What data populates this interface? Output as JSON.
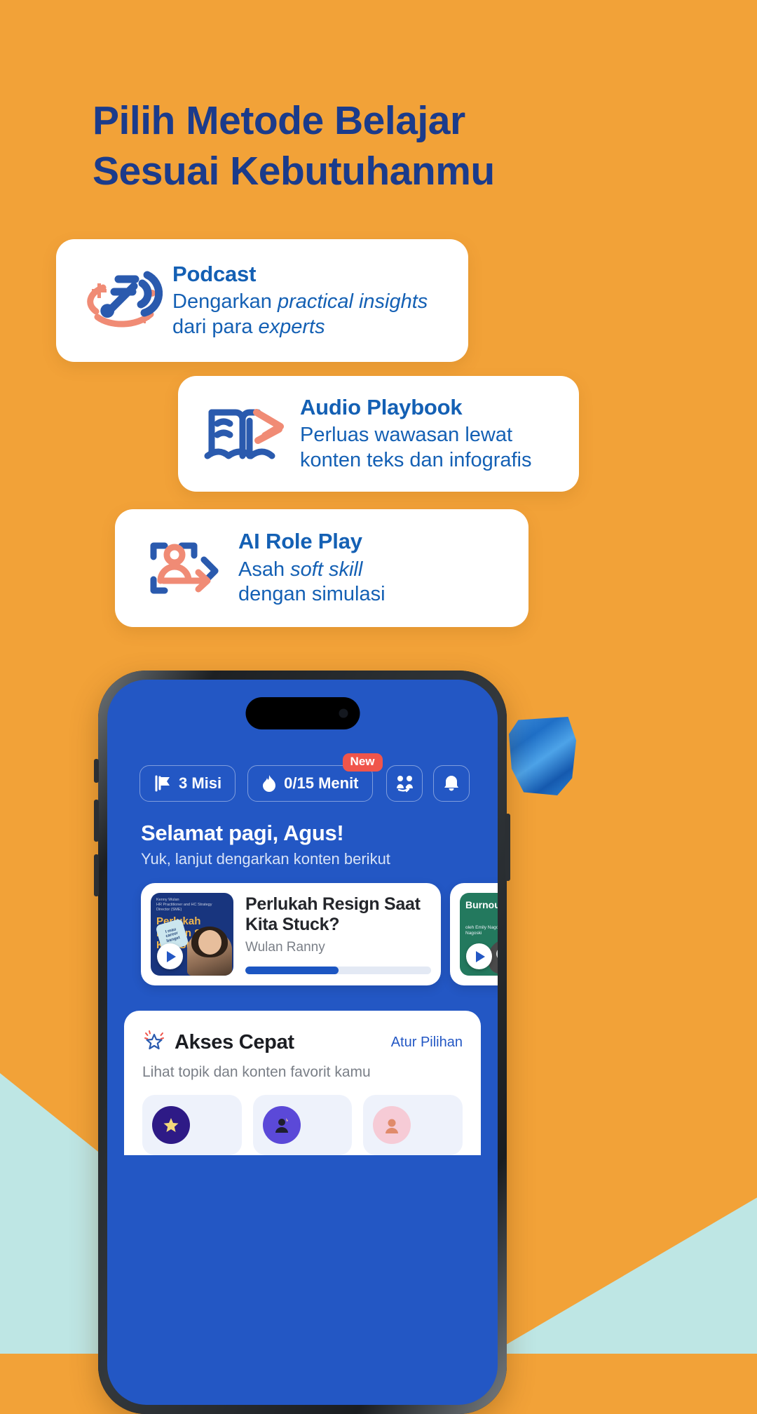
{
  "theme": {
    "background": "#F2A238",
    "headline_color": "#1B3B8B",
    "card_title_color": "#1460B4",
    "accent_blue": "#2357C4",
    "accent_coral": "#F08B75",
    "mint": "#BEE6E4",
    "badge_red": "#F0554B"
  },
  "headline": {
    "line1": "Pilih Metode Belajar",
    "line2": "Sesuai Kebutuhanmu"
  },
  "feature_cards": [
    {
      "id": "podcast",
      "icon": "podcast-microphone-icon",
      "title": "Podcast",
      "desc_parts": [
        {
          "text": "Dengarkan ",
          "italic": false
        },
        {
          "text": "practical insights",
          "italic": true
        },
        {
          "text": " dari para ",
          "italic": false
        },
        {
          "text": "experts",
          "italic": true
        }
      ]
    },
    {
      "id": "audio-playbook",
      "icon": "open-book-play-icon",
      "title": "Audio Playbook",
      "desc_parts": [
        {
          "text": "Perluas wawasan lewat konten teks dan infografis",
          "italic": false
        }
      ]
    },
    {
      "id": "ai-role-play",
      "icon": "person-arrow-frame-icon",
      "title": "AI Role Play",
      "desc_parts": [
        {
          "text": "Asah ",
          "italic": false
        },
        {
          "text": "soft skill",
          "italic": true
        },
        {
          "text": " dengan simulasi",
          "italic": false
        }
      ]
    }
  ],
  "phone": {
    "chips": [
      {
        "id": "misi",
        "icon": "flag-icon",
        "label": "3 Misi",
        "badge": null
      },
      {
        "id": "menit",
        "icon": "flame-icon",
        "label": "0/15 Menit",
        "badge": "New"
      }
    ],
    "top_actions": [
      {
        "id": "invite-friends",
        "icon": "people-share-icon"
      },
      {
        "id": "notifications",
        "icon": "bell-icon"
      }
    ],
    "greeting": {
      "title": "Selamat pagi, Agus!",
      "subtitle": "Yuk, lanjut dengarkan konten berikut"
    },
    "player_cards": [
      {
        "id": "perlukah-resign",
        "thumb_brand": "Kenny Wulan",
        "thumb_brand_sub": "HR Practitioner and HC Strategy Director (SME)",
        "thumb_title": "Perlukah Resign Saat Kita Stuck?",
        "thumb_badge": "I mau career banget",
        "title": "Perlukah Resign Saat Kita Stuck?",
        "author": "Wulan Ranny",
        "progress_percent": 50,
        "play_button": "play-icon"
      },
      {
        "id": "burnout",
        "thumb_title": "Burnout",
        "thumb_sub": "oleh Emily Nagoski & Amelia Nagoski",
        "title": "",
        "author": "",
        "progress_percent": 0,
        "play_button": "play-icon"
      }
    ],
    "quick_access": {
      "icon": "sparkle-star-icon",
      "title": "Akses Cepat",
      "link": "Atur Pilihan",
      "subtitle": "Lihat topik dan konten favorit kamu",
      "tiles": [
        {
          "id": "tile-1",
          "avatar": "star-avatar"
        },
        {
          "id": "tile-2",
          "avatar": "person-avatar"
        },
        {
          "id": "tile-3",
          "avatar": "pink-avatar"
        }
      ]
    }
  },
  "decor": {
    "sticker": "blue-crumpled-sticker"
  }
}
